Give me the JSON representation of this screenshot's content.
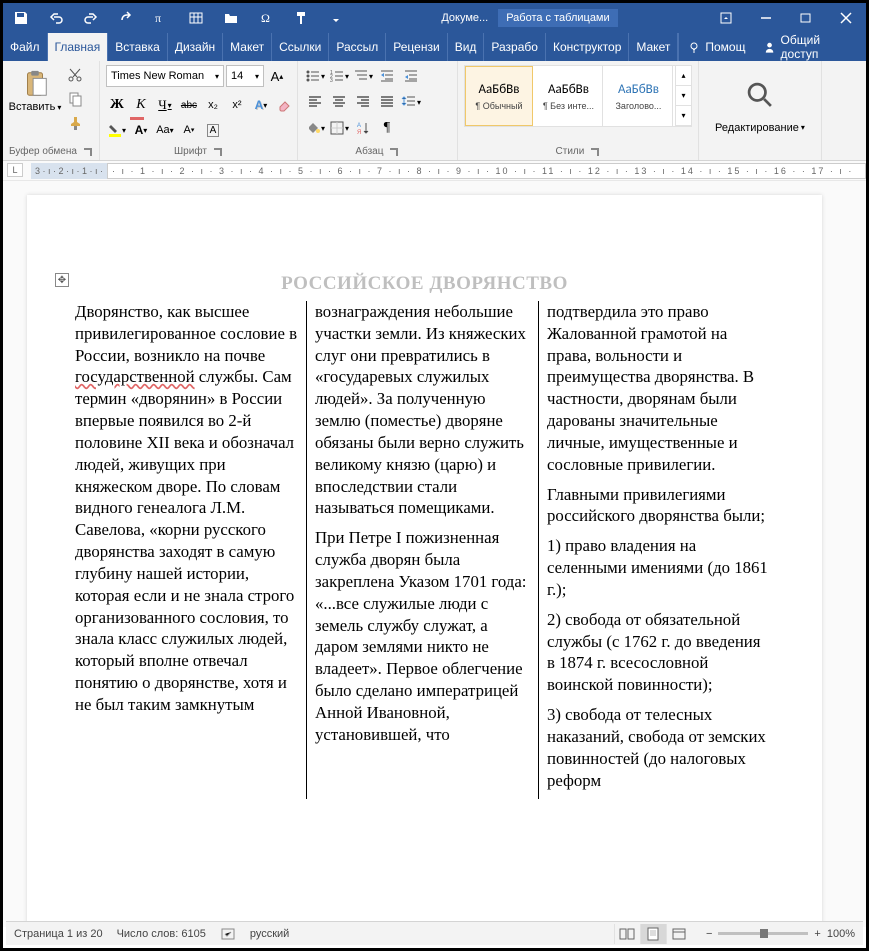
{
  "qat": {
    "doc_title": "Докуме...",
    "table_tools": "Работа с таблицами"
  },
  "tabs": {
    "file": "Файл",
    "home": "Главная",
    "insert": "Вставка",
    "design": "Дизайн",
    "layout": "Макет",
    "refs": "Ссылки",
    "mail": "Рассыл",
    "review": "Рецензи",
    "view": "Вид",
    "dev": "Разрабо",
    "tdesign": "Конструктор",
    "tlayout": "Макет",
    "help": "Помощ",
    "share": "Общий доступ"
  },
  "ribbon": {
    "clipboard": {
      "label": "Буфер обмена",
      "paste": "Вставить"
    },
    "font": {
      "label": "Шрифт",
      "name": "Times New Roman",
      "size": "14",
      "bold": "Ж",
      "italic": "К",
      "underline": "Ч",
      "strike": "abc",
      "sub": "x₂",
      "sup": "x²"
    },
    "para": {
      "label": "Абзац"
    },
    "styles": {
      "label": "Стили",
      "preview": "АаБбВв",
      "s1": "¶ Обычный",
      "s2": "¶ Без инте...",
      "s3": "Заголово..."
    },
    "edit": {
      "label": "Редактирование"
    }
  },
  "ruler": {
    "corner": "L",
    "left_marks": "3 · ı · 2 · ı · 1 · ı ·",
    "main": " · ı · 1 · ı · 2 · ı · 3 · ı · 4 · ı · 5 · ı · 6 · ı · 7 · ı · 8 · ı · 9 · ı · 10 · ı · 11 · ı · 12 · ı · 13 · ı · 14 · ı · 15 · ı · 16 ·   · 17 · ı ·"
  },
  "document": {
    "title": "РОССИЙСКОЕ ДВОРЯНСТВО",
    "col1_p1a": "Дворянство, как высшее привилегированное сословие в России, возникло на почве ",
    "col1_p1_err": "государственной",
    "col1_p1b": " службы. Сам термин «дворянин» в России впервые появился во 2-й половине XII века и обозначал людей, живущих при княжеском дворе. По словам видного генеалога Л.М. Савелова, «корни русского дворянства заходят в самую глубину нашей истории, которая если и не знала строго организованного сословия, то знала класс служилых людей, который вполне отвечал понятию о дворянстве, хотя и не был таким замкнутым",
    "col2_p1": "вознаграждения небольшие участки земли. Из княжеских слуг они превратились в «государевых служилых людей». За полученную землю (поместье) дворяне обязаны были верно служить великому князю (царю) и впоследствии стали называться помещиками.",
    "col2_p2": "При Петре I пожизненная служба дворян была закреплена Указом 1701 года: «...все служилые люди с земель службу служат, а даром землями никто не владеет». Первое облегчение было сделано императрицей Анной Ивановной, установившей, что",
    "col3_p1": "подтвердила это право Жалованной грамотой на права, вольности и преимущества дворянства. В частности, дворянам были дарованы значительные личные, имущественные и сословные привилегии.",
    "col3_p2": "Главными привилегиями российского дворянства были;",
    "col3_p3": "1) право владения на селенными имениями (до 1861 г.);",
    "col3_p4": "2) свобода от обязательной службы (с 1762 г. до введения в 1874 г. всесословной воинской повинности);",
    "col3_p5": "3) свобода от телесных наказаний, свобода от земских повинностей (до налоговых реформ"
  },
  "status": {
    "page": "Страница 1 из 20",
    "words": "Число слов: 6105",
    "lang": "русский",
    "zoom": "100%"
  }
}
